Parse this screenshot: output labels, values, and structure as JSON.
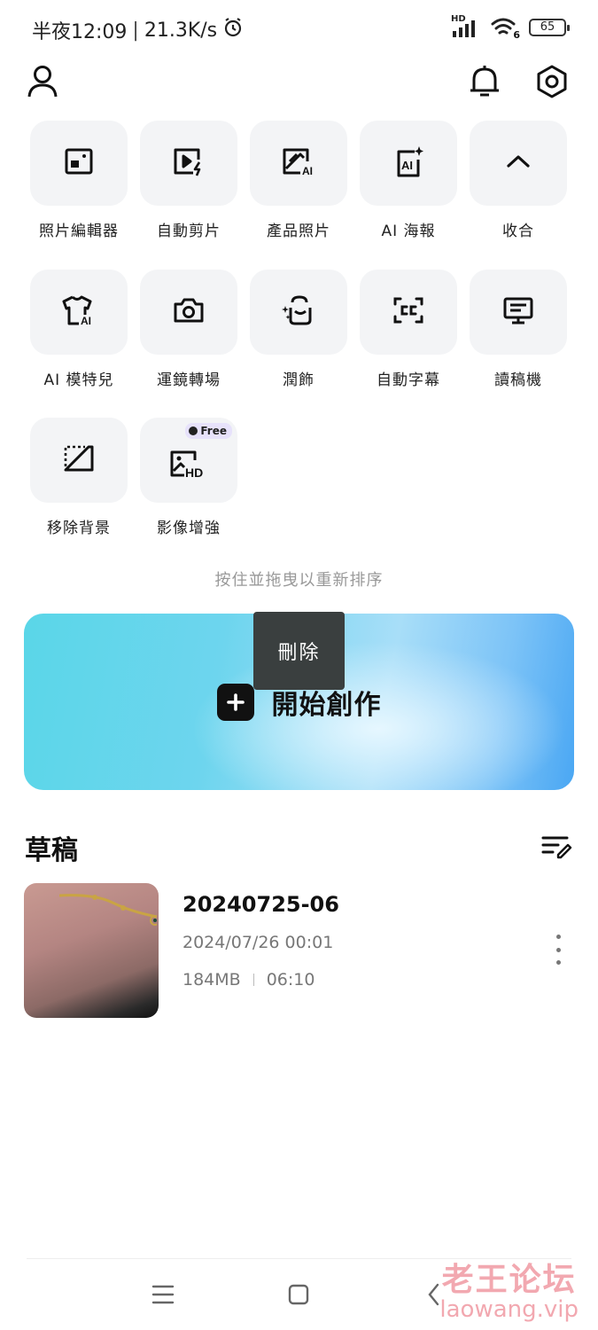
{
  "status": {
    "time": "半夜12:09",
    "speed": "21.3K/s",
    "network": "HD",
    "wifi_sub": "6",
    "battery": "65"
  },
  "icons": {
    "profile": "person-icon",
    "notifications": "bell-icon",
    "settings": "hexagon-gear-icon"
  },
  "tools": [
    {
      "label": "照片編輯器",
      "icon": "photo-edit-icon"
    },
    {
      "label": "自動剪片",
      "icon": "auto-cut-icon"
    },
    {
      "label": "產品照片",
      "icon": "product-photo-icon"
    },
    {
      "label": "AI 海報",
      "icon": "ai-poster-icon"
    },
    {
      "label": "收合",
      "icon": "chevron-up-icon"
    },
    {
      "label": "AI 模特兒",
      "icon": "ai-model-icon"
    },
    {
      "label": "運鏡轉場",
      "icon": "camera-icon"
    },
    {
      "label": "潤飾",
      "icon": "retouch-icon"
    },
    {
      "label": "自動字幕",
      "icon": "captions-icon"
    },
    {
      "label": "讀稿機",
      "icon": "teleprompter-icon"
    },
    {
      "label": "移除背景",
      "icon": "remove-bg-icon"
    },
    {
      "label": "影像增強",
      "icon": "hd-enhance-icon",
      "badge": "Free"
    }
  ],
  "hint": "按住並拖曳以重新排序",
  "tooltip": "刪除",
  "create": {
    "label": "開始創作"
  },
  "drafts": {
    "title": "草稿",
    "items": [
      {
        "name": "20240725-06",
        "date": "2024/07/26 00:01",
        "size": "184MB",
        "duration": "06:10"
      }
    ]
  },
  "watermark": {
    "cn": "老王论坛",
    "en": "laowang.vip"
  },
  "colors": {
    "tile_bg": "#f3f4f6",
    "banner_start": "#5ad6e8",
    "banner_end": "#4aa7f3",
    "tooltip_bg": "#3a3f3f",
    "watermark": "#f2a8b0"
  }
}
